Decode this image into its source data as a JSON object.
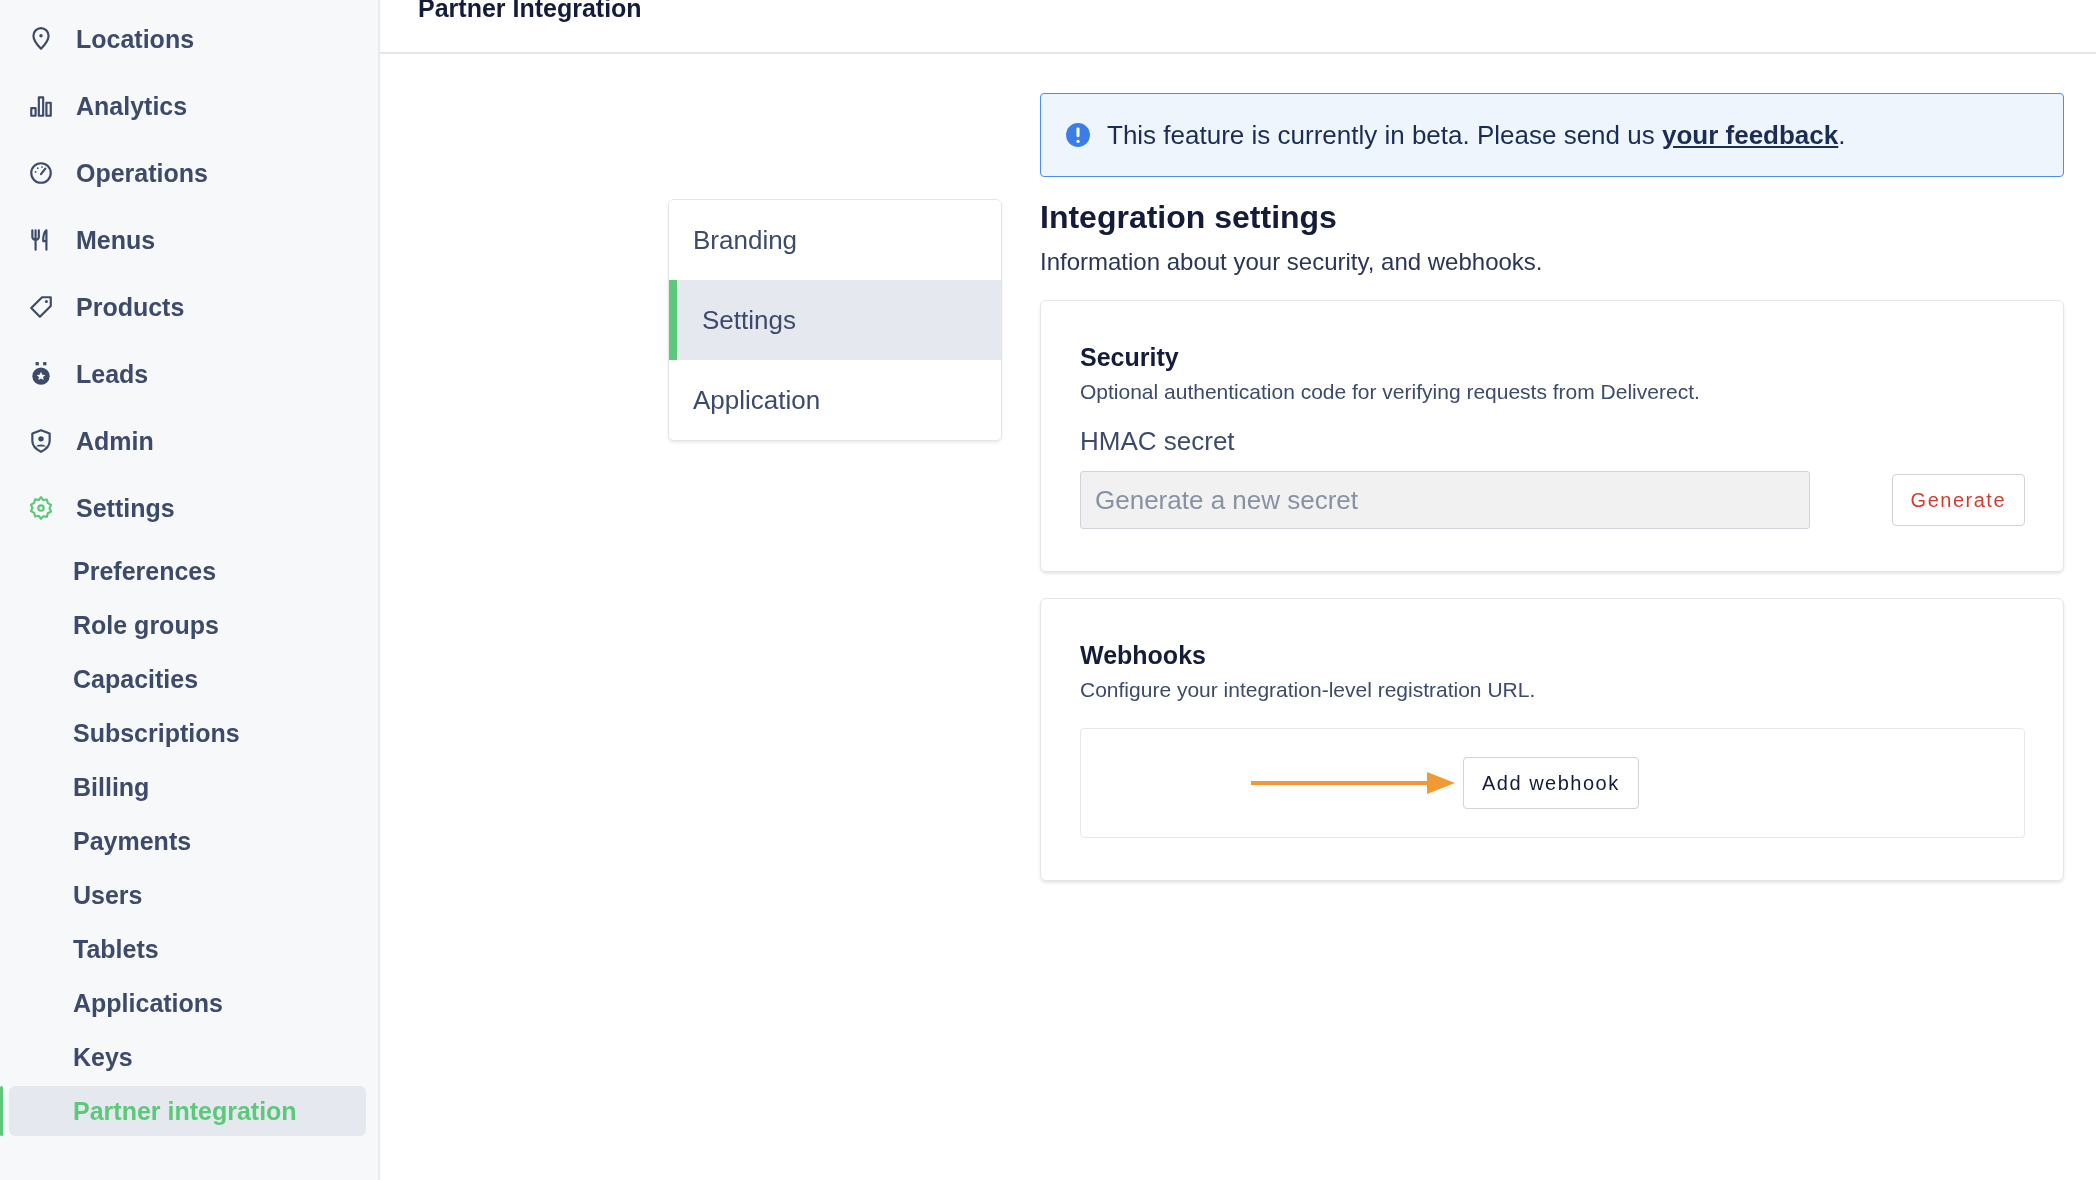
{
  "header": {
    "title": "Partner Integration"
  },
  "sidebar": {
    "items": [
      {
        "label": "Locations",
        "selected": false
      },
      {
        "label": "Analytics",
        "selected": false
      },
      {
        "label": "Operations",
        "selected": false
      },
      {
        "label": "Menus",
        "selected": false
      },
      {
        "label": "Products",
        "selected": false
      },
      {
        "label": "Leads",
        "selected": false
      },
      {
        "label": "Admin",
        "selected": false
      },
      {
        "label": "Settings",
        "selected": true,
        "expanded": true,
        "children": [
          {
            "label": "Preferences",
            "selected": false
          },
          {
            "label": "Role groups",
            "selected": false
          },
          {
            "label": "Capacities",
            "selected": false
          },
          {
            "label": "Subscriptions",
            "selected": false
          },
          {
            "label": "Billing",
            "selected": false
          },
          {
            "label": "Payments",
            "selected": false
          },
          {
            "label": "Users",
            "selected": false
          },
          {
            "label": "Tablets",
            "selected": false
          },
          {
            "label": "Applications",
            "selected": false
          },
          {
            "label": "Keys",
            "selected": false
          },
          {
            "label": "Partner integration",
            "selected": true
          }
        ]
      }
    ]
  },
  "tabs": [
    {
      "label": "Branding",
      "selected": false
    },
    {
      "label": "Settings",
      "selected": true
    },
    {
      "label": "Application",
      "selected": false
    }
  ],
  "banner": {
    "text": "This feature is currently in beta. Please send us ",
    "link": "your feedback",
    "end": "."
  },
  "settings": {
    "title": "Integration settings",
    "subtitle": "Information about your security, and webhooks.",
    "security": {
      "title": "Security",
      "description": "Optional authentication code for verifying requests from Deliverect.",
      "field_label": "HMAC secret",
      "placeholder": "Generate a new secret",
      "button": "Generate"
    },
    "webhooks": {
      "title": "Webhooks",
      "description": "Configure your integration-level registration URL.",
      "button": "Add webhook"
    }
  }
}
